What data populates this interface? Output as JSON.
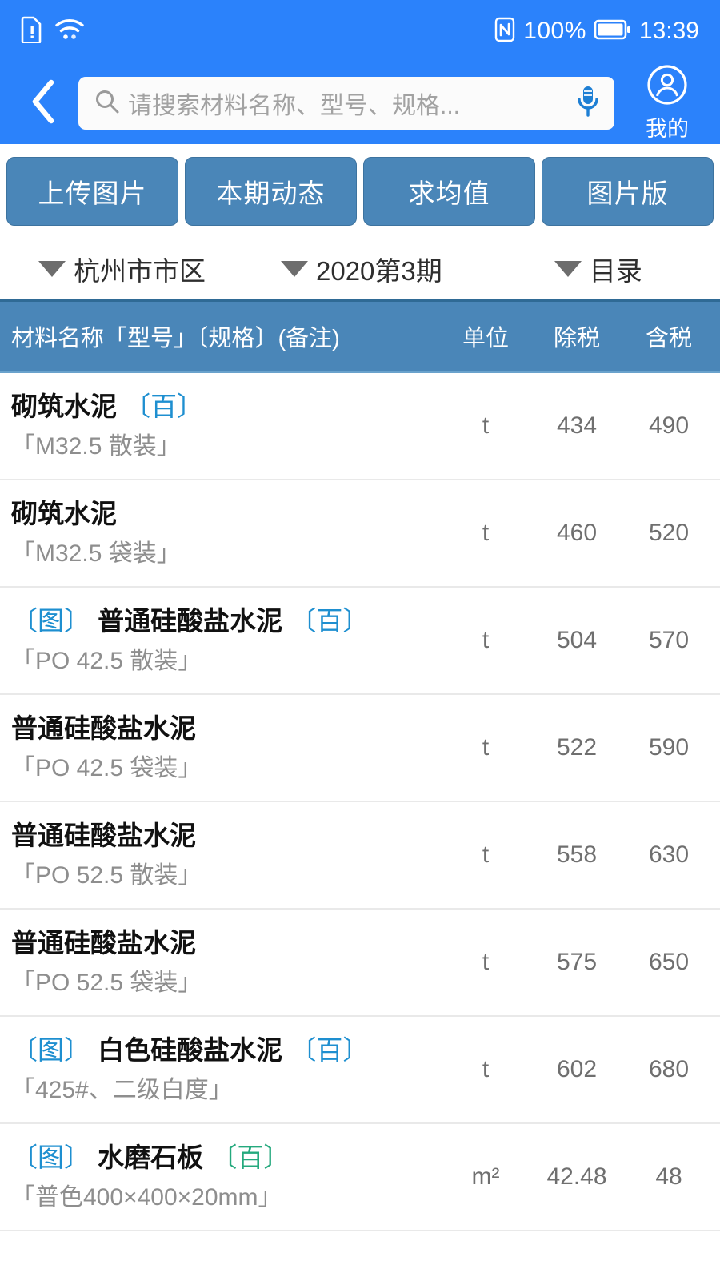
{
  "statusbar": {
    "sim_icon": "sim-alert-icon",
    "wifi_icon": "wifi-icon",
    "nfc_icon": "nfc-icon",
    "battery_percent": "100%",
    "battery_icon": "battery-full-icon",
    "time": "13:39"
  },
  "header": {
    "back_icon": "chevron-left-icon",
    "search": {
      "icon": "search-icon",
      "placeholder": "请搜索材料名称、型号、规格...",
      "value": "",
      "mic_icon": "microphone-icon"
    },
    "profile": {
      "icon": "user-circle-icon",
      "label": "我的"
    }
  },
  "toolbar": {
    "buttons": [
      {
        "label": "上传图片"
      },
      {
        "label": "本期动态"
      },
      {
        "label": "求均值"
      },
      {
        "label": "图片版"
      }
    ]
  },
  "filters": [
    {
      "label": "杭州市市区",
      "icon": "caret-down-icon"
    },
    {
      "label": "2020第3期",
      "icon": "caret-down-icon"
    },
    {
      "label": "目录",
      "icon": "caret-down-icon"
    }
  ],
  "table": {
    "columns": {
      "name": "材料名称「型号」〔规格〕(备注)",
      "unit": "单位",
      "ex_tax": "除税",
      "in_tax": "含税"
    },
    "rows": [
      {
        "img_tag": "",
        "name": "砌筑水泥",
        "bai_tag": "〔百〕",
        "bai_color": "blue",
        "spec": "「M32.5 散装」",
        "unit": "t",
        "ex_tax": "434",
        "in_tax": "490"
      },
      {
        "img_tag": "",
        "name": "砌筑水泥",
        "bai_tag": "",
        "bai_color": "blue",
        "spec": "「M32.5 袋装」",
        "unit": "t",
        "ex_tax": "460",
        "in_tax": "520"
      },
      {
        "img_tag": "〔图〕",
        "name": "普通硅酸盐水泥",
        "bai_tag": "〔百〕",
        "bai_color": "blue",
        "spec": "「PO 42.5 散装」",
        "unit": "t",
        "ex_tax": "504",
        "in_tax": "570"
      },
      {
        "img_tag": "",
        "name": "普通硅酸盐水泥",
        "bai_tag": "",
        "bai_color": "blue",
        "spec": "「PO 42.5 袋装」",
        "unit": "t",
        "ex_tax": "522",
        "in_tax": "590"
      },
      {
        "img_tag": "",
        "name": "普通硅酸盐水泥",
        "bai_tag": "",
        "bai_color": "blue",
        "spec": "「PO 52.5 散装」",
        "unit": "t",
        "ex_tax": "558",
        "in_tax": "630"
      },
      {
        "img_tag": "",
        "name": "普通硅酸盐水泥",
        "bai_tag": "",
        "bai_color": "blue",
        "spec": "「PO 52.5 袋装」",
        "unit": "t",
        "ex_tax": "575",
        "in_tax": "650"
      },
      {
        "img_tag": "〔图〕",
        "name": "白色硅酸盐水泥",
        "bai_tag": "〔百〕",
        "bai_color": "blue",
        "spec": "「425#、二级白度」",
        "unit": "t",
        "ex_tax": "602",
        "in_tax": "680"
      },
      {
        "img_tag": "〔图〕",
        "name": "水磨石板",
        "bai_tag": "〔百〕",
        "bai_color": "green",
        "spec": "「普色400×400×20mm」",
        "unit": "m²",
        "ex_tax": "42.48",
        "in_tax": "48"
      }
    ]
  },
  "colors": {
    "header_blue": "#2B82FB",
    "button_blue": "#4A86B8",
    "tag_blue": "#1E8FD0",
    "tag_green": "#24a97d",
    "value_gray": "#6f6f6f",
    "spec_gray": "#8e8e8e"
  }
}
